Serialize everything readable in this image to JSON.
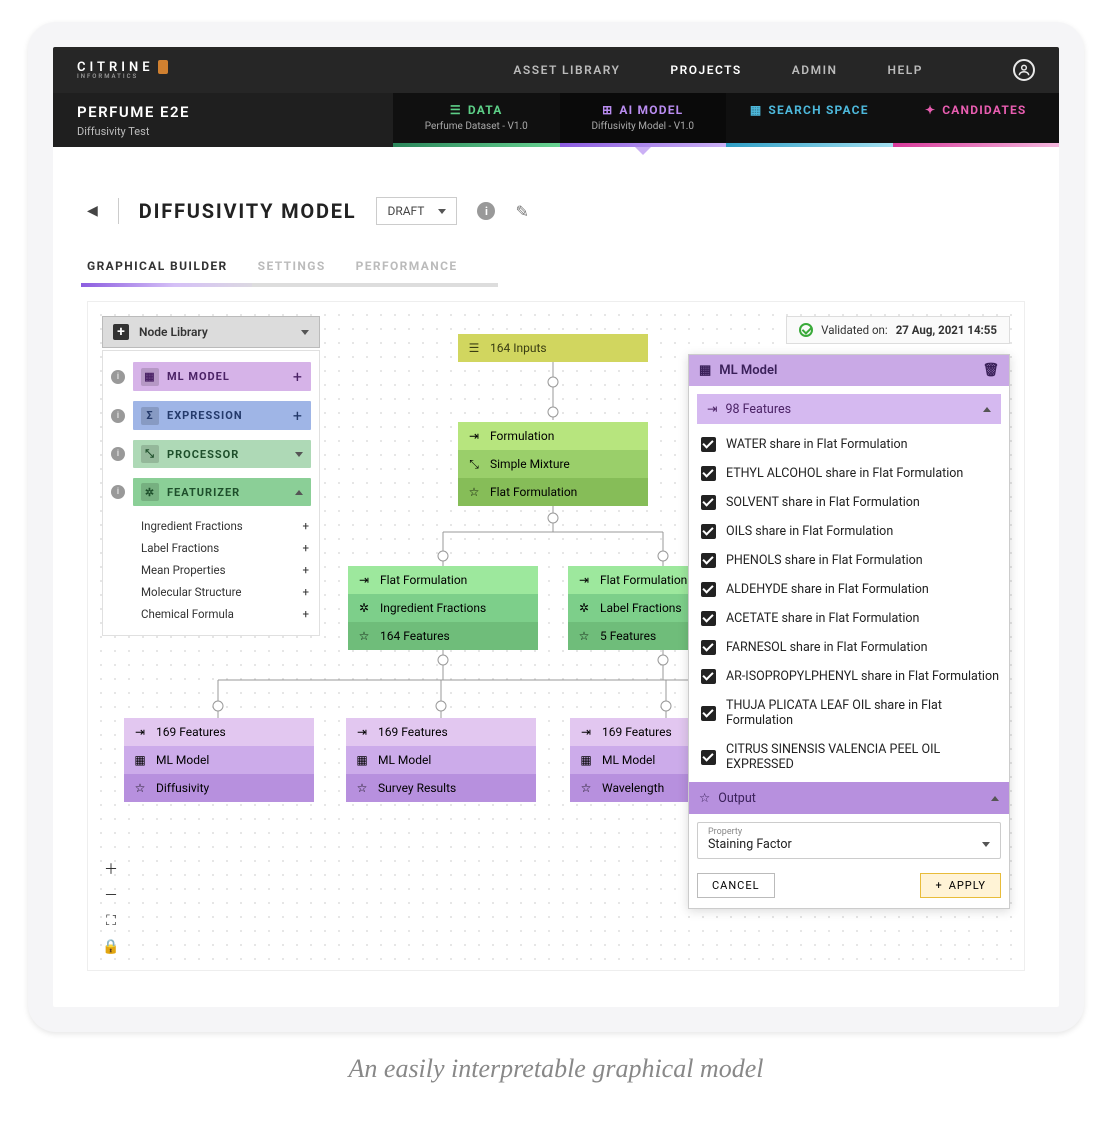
{
  "logo": {
    "text": "CITRINE",
    "sub": "INFORMATICS"
  },
  "topnav": {
    "asset_library": "ASSET LIBRARY",
    "projects": "PROJECTS",
    "admin": "ADMIN",
    "help": "HELP"
  },
  "project": {
    "title": "PERFUME E2E",
    "subtitle": "Diffusivity Test"
  },
  "subtabs": {
    "data": {
      "label": "DATA",
      "sub": "Perfume Dataset - V1.0"
    },
    "ai_model": {
      "label": "AI MODEL",
      "sub": "Diffusivity Model - V1.0"
    },
    "search_space": {
      "label": "SEARCH SPACE"
    },
    "candidates": {
      "label": "CANDIDATES"
    }
  },
  "page": {
    "title": "DIFFUSIVITY MODEL",
    "status": "DRAFT"
  },
  "tabs2": {
    "graphical": "GRAPHICAL BUILDER",
    "settings": "SETTINGS",
    "performance": "PERFORMANCE"
  },
  "nodelib": {
    "header": "Node Library",
    "ml_model": "ML MODEL",
    "expression": "EXPRESSION",
    "processor": "PROCESSOR",
    "featurizer": "FEATURIZER",
    "subitems": [
      "Ingredient Fractions",
      "Label Fractions",
      "Mean Properties",
      "Molecular Structure",
      "Chemical Formula"
    ]
  },
  "validated": {
    "prefix": "Validated on:",
    "date": "27 Aug, 2021 14:55"
  },
  "nodes": {
    "inputs": {
      "r0": "164 Inputs"
    },
    "form": {
      "r1": "Formulation",
      "r2": "Simple Mixture",
      "r3": "Flat Formulation"
    },
    "left_child": {
      "r1": "Flat Formulation",
      "r2": "Ingredient Fractions",
      "r3": "164 Features"
    },
    "right_child": {
      "r1": "Flat Formulation",
      "r2": "Label Fractions",
      "r3": "5 Features"
    },
    "out1": {
      "r1": "169 Features",
      "r2": "ML Model",
      "r3": "Diffusivity"
    },
    "out2": {
      "r1": "169 Features",
      "r2": "ML Model",
      "r3": "Survey Results"
    },
    "out3": {
      "r1": "169 Features",
      "r2": "ML Model",
      "r3": "Wavelength"
    }
  },
  "panel": {
    "header": "ML Model",
    "features_hdr": "98 Features",
    "features": [
      "WATER share in Flat Formulation",
      "ETHYL ALCOHOL share in Flat Formulation",
      "SOLVENT share in Flat Formulation",
      "OILS share in Flat Formulation",
      "PHENOLS share in Flat Formulation",
      "ALDEHYDE share in Flat Formulation",
      "ACETATE share in Flat Formulation",
      "FARNESOL share in Flat Formulation",
      "AR-ISOPROPYLPHENYL share in Flat Formulation",
      "THUJA PLICATA LEAF OIL share in Flat Formulation",
      "CITRUS SINENSIS VALENCIA PEEL OIL EXPRESSED"
    ],
    "output_hdr": "Output",
    "property_label": "Property",
    "property_value": "Staining Factor",
    "cancel": "CANCEL",
    "apply": "APPLY"
  },
  "caption": "An easily interpretable graphical model"
}
